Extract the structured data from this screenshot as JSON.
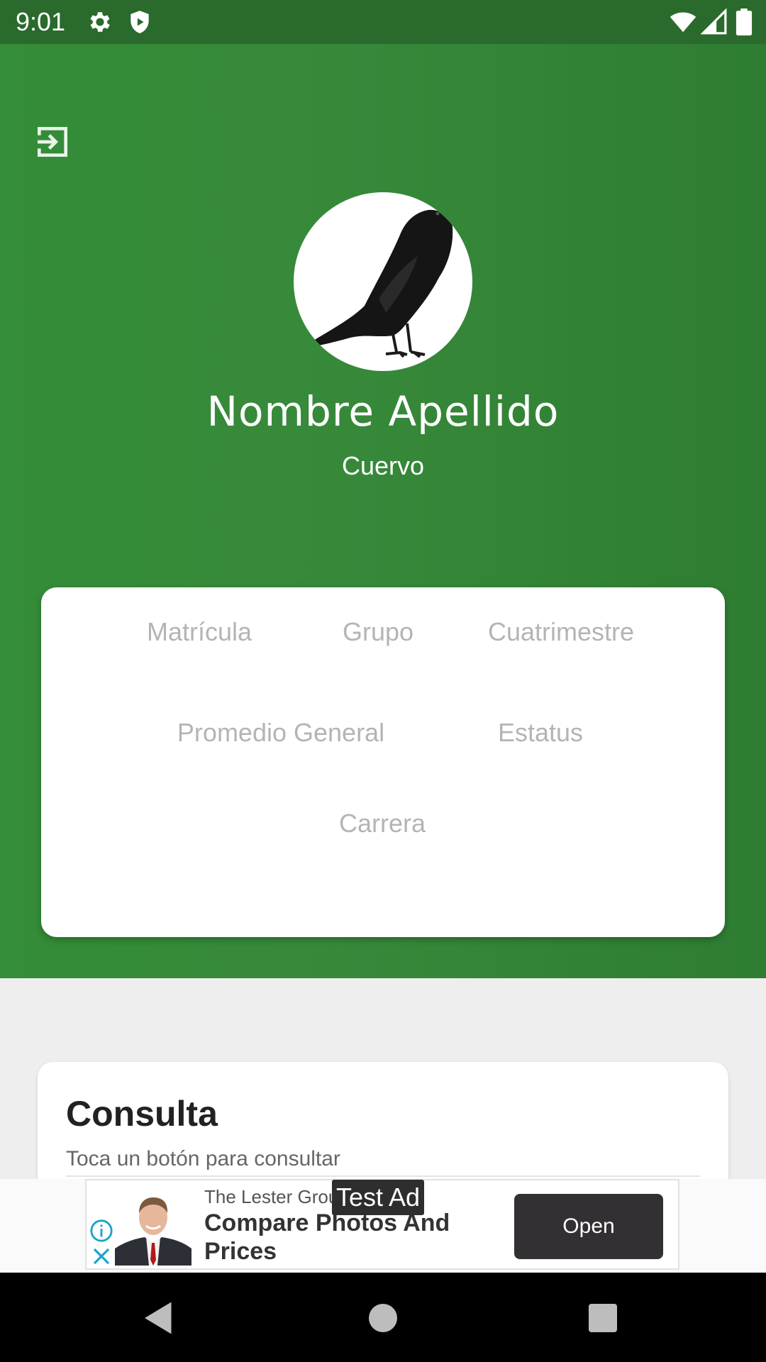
{
  "status_bar": {
    "time": "9:01",
    "icons": [
      "settings-icon",
      "shield-icon",
      "wifi-icon",
      "signal-icon",
      "battery-icon"
    ]
  },
  "header": {
    "logout_icon": "logout-icon",
    "avatar": "crow-avatar",
    "name": "Nombre Apellido",
    "role": "Cuervo",
    "color": "#388e3c"
  },
  "info_card": {
    "fields": {
      "matricula": "Matrícula",
      "grupo": "Grupo",
      "cuatrimestre": "Cuatrimestre",
      "promedio": "Promedio General",
      "estatus": "Estatus",
      "carrera": "Carrera"
    }
  },
  "consulta": {
    "title": "Consulta",
    "subtitle": "Toca un botón para consultar"
  },
  "ad": {
    "test_label": "Test Ad",
    "advertiser": "The Lester Group",
    "headline": "Compare Photos And Prices",
    "button": "Open",
    "info_icon": "info-icon",
    "close_icon": "close-icon"
  },
  "nav": {
    "icons": [
      "back-icon",
      "home-icon",
      "recents-icon"
    ]
  }
}
